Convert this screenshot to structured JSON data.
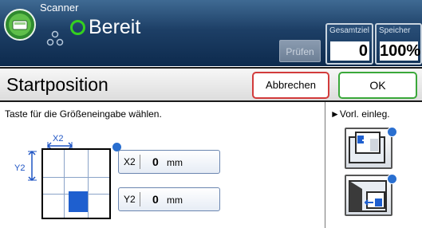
{
  "header": {
    "app_name": "Scanner",
    "status": "Bereit",
    "check_button": "Prüfen",
    "counters": [
      {
        "label": "Gesamtziel",
        "value": "0"
      },
      {
        "label": "Speicher",
        "value": "100%"
      }
    ],
    "colors": {
      "status_ring": "#35d01f",
      "header_bg": "#1d3f66"
    }
  },
  "titlebar": {
    "title": "Startposition",
    "cancel_label": "Abbrechen",
    "ok_label": "OK"
  },
  "main": {
    "instruction": "Taste für die Größeneingabe wählen.",
    "axis_x_label": "X2",
    "axis_y_label": "Y2",
    "fields": [
      {
        "label": "X2",
        "value": "0",
        "unit": "mm"
      },
      {
        "label": "Y2",
        "value": "0",
        "unit": "mm"
      }
    ],
    "side_label": "►Vorl. einleg.",
    "side_icons": [
      "original-on-glass-icon",
      "original-in-adf-icon"
    ]
  }
}
